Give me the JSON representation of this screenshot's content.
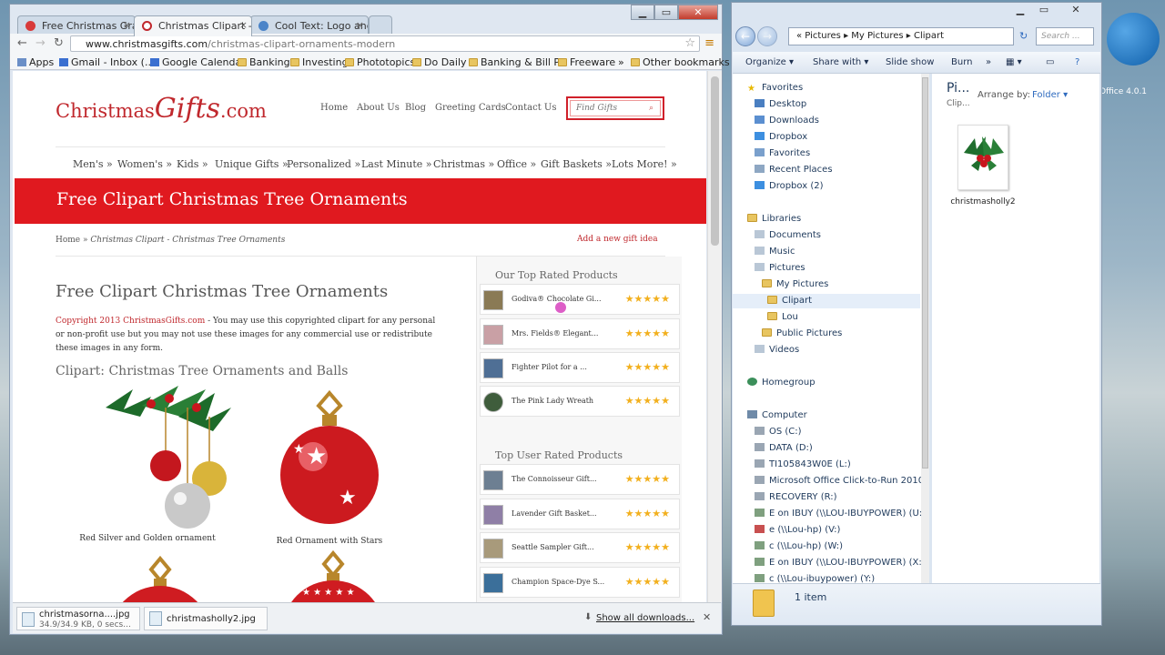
{
  "desktop": {
    "office_label": "Office 4.0.1"
  },
  "browser": {
    "tabs": [
      {
        "label": "Free Christmas Grap",
        "active": false
      },
      {
        "label": "Christmas Clipart - C",
        "active": true
      },
      {
        "label": "Cool Text: Logo and",
        "active": false
      }
    ],
    "url_host": "www.christmasgifts.com",
    "url_path": "/christmas-clipart-ornaments-modern",
    "bookmarks": [
      "Apps",
      "Gmail - Inbox (...",
      "Google Calendar",
      "Banking",
      "Investing",
      "Phototopics",
      "Do Daily",
      "Banking & Bill P...",
      "Freeware",
      "»",
      "Other bookmarks"
    ]
  },
  "site": {
    "logo_a": "Christmas",
    "logo_b": "Gifts",
    "logo_c": ".com",
    "topnav": [
      "Home",
      "About Us",
      "Blog",
      "Greeting Cards",
      "Contact Us"
    ],
    "search_placeholder": "Find Gifts",
    "categories": [
      "Men's »",
      "Women's »",
      "Kids »",
      "Unique Gifts »",
      "Personalized »",
      "Last Minute »",
      "Christmas »",
      "Office »",
      "Gift Baskets »",
      "Lots More! »"
    ],
    "banner": "Free Clipart Christmas Tree Ornaments",
    "crumb_home": "Home",
    "crumb_sep": " » ",
    "crumb_current": "Christmas Clipart - Christmas Tree Ornaments",
    "add_gift": "Add a new gift idea",
    "article_title": "Free Clipart Christmas Tree Ornaments",
    "copyright_link": "Copyright 2013 ChristmasGifts.com",
    "article_body": " - You may use this copyrighted clipart for any personal or non-profit use but you may not use these images for any commercial use or redistribute these images in any form.",
    "article_sub": "Clipart: Christmas Tree Ornaments and Balls",
    "captions": [
      "Red Silver and Golden ornament",
      "Red Ornament with Stars"
    ],
    "sidebar_top_title": "Our Top Rated Products",
    "sidebar_top": [
      "Godiva® Chocolate Gi...",
      "Mrs. Fields® Elegant...",
      "Fighter Pilot for a ...",
      "The Pink Lady Wreath"
    ],
    "sidebar_user_title": "Top User Rated Products",
    "sidebar_user": [
      "The Connoisseur Gift...",
      "Lavender Gift Basket...",
      "Seattle Sampler Gift...",
      "Champion Space-Dye S..."
    ],
    "stars": "★★★★★"
  },
  "downloads": {
    "item1_name": "christmasorna....jpg",
    "item1_status": "34.9/34.9 KB, 0 secs...",
    "item2_name": "christmasholly2.jpg",
    "show_all": "Show all downloads..."
  },
  "explorer": {
    "breadcrumb": "« Pictures ▸ My Pictures ▸ Clipart",
    "search_placeholder": "Search ...",
    "commands": [
      "Organize ▾",
      "Share with ▾",
      "Slide show",
      "Burn",
      "»"
    ],
    "nav": {
      "favorites": "Favorites",
      "fav_items": [
        "Desktop",
        "Downloads",
        "Dropbox",
        "Favorites",
        "Recent Places",
        "Dropbox (2)"
      ],
      "libraries": "Libraries",
      "lib_items": [
        "Documents",
        "Music",
        "Pictures"
      ],
      "pictures_sub": [
        "My Pictures",
        "Clipart",
        "Lou",
        "Public Pictures"
      ],
      "videos": "Videos",
      "homegroup": "Homegroup",
      "computer": "Computer",
      "drives": [
        "OS (C:)",
        "DATA (D:)",
        "TI105843W0E (L:)",
        "Microsoft Office Click-to-Run 2010 (P",
        "RECOVERY (R:)",
        "E on IBUY (\\\\LOU-IBUYPOWER) (U:)",
        "e (\\\\Lou-hp) (V:)",
        "c (\\\\Lou-hp) (W:)",
        "E on IBUY (\\\\LOU-IBUYPOWER) (X:)",
        "c (\\\\Lou-ibuypower) (Y:)"
      ]
    },
    "content_title": "Pi...",
    "content_sub": "Clip...",
    "arrange_label": "Arrange by:",
    "arrange_value": "Folder ▾",
    "file_name": "christmasholly2",
    "item_count": "1 item"
  }
}
